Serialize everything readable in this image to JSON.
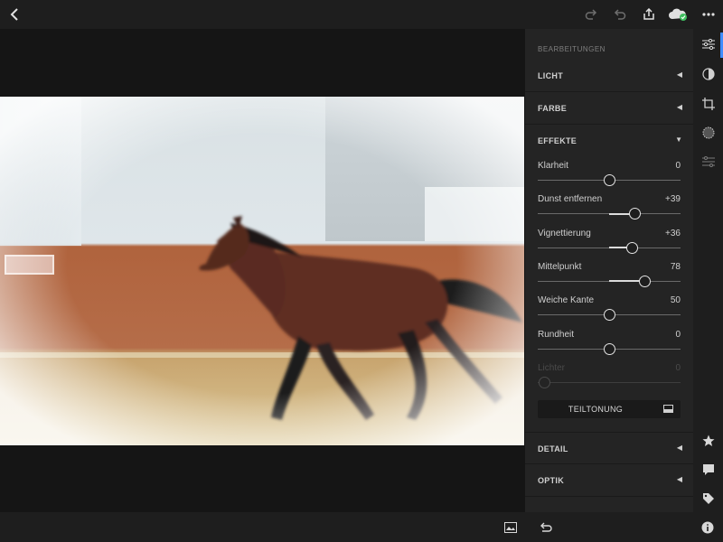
{
  "topbar": {
    "back_icon": "chevron-left-icon",
    "redo_icon": "redo-icon",
    "undo_icon": "undo-icon",
    "share_icon": "share-icon",
    "cloud_icon": "cloud-sync-icon",
    "more_icon": "more-icon"
  },
  "panel": {
    "title": "BEARBEITUNGEN",
    "sections": {
      "licht": "LICHT",
      "farbe": "FARBE",
      "effekte": "EFFEKTE",
      "detail": "DETAIL",
      "optik": "OPTIK"
    },
    "sliders": [
      {
        "label": "Klarheit",
        "value": "0",
        "position": 0.5
      },
      {
        "label": "Dunst entfernen",
        "value": "+39",
        "position": 0.68
      },
      {
        "label": "Vignettierung",
        "value": "+36",
        "position": 0.66
      },
      {
        "label": "Mittelpunkt",
        "value": "78",
        "position": 0.75
      },
      {
        "label": "Weiche Kante",
        "value": "50",
        "position": 0.5
      },
      {
        "label": "Rundheit",
        "value": "0",
        "position": 0.5
      },
      {
        "label": "Lichter",
        "value": "0",
        "position": 0.05,
        "disabled": true
      }
    ],
    "teiltonung_label": "TEILTONUNG"
  },
  "rail": {
    "icons": [
      "sliders-icon",
      "color-mix-icon",
      "crop-icon",
      "vignette-icon",
      "presets-icon"
    ],
    "bottom_icons": [
      "star-icon",
      "comment-icon",
      "tag-icon",
      "info-icon"
    ]
  },
  "colors": {
    "accent": "#3f8cff",
    "cloud_badge": "#3fbf5f"
  }
}
